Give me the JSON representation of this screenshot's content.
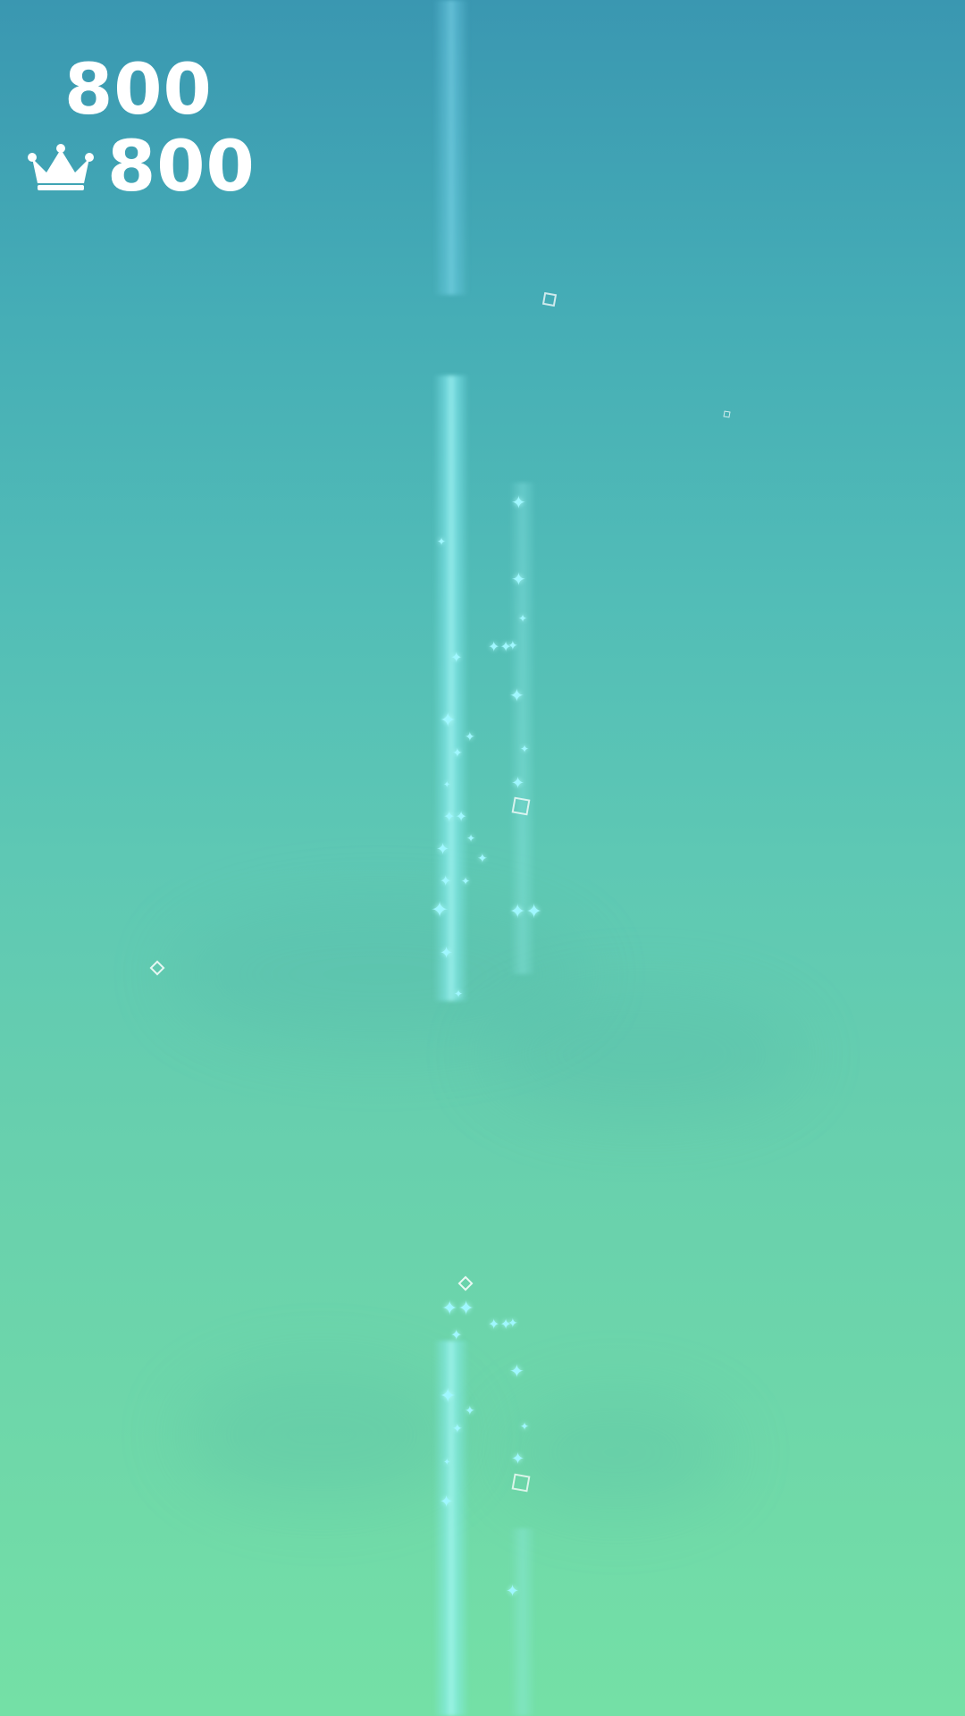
{
  "game": {
    "score": "800",
    "best_score": "800"
  },
  "icons": {
    "best": "crown-icon"
  },
  "colors": {
    "background_top": "#3a97b1",
    "background_bottom": "#74e0a6",
    "hud_text": "#ffffff",
    "sparkle": "#9ff7ff"
  }
}
